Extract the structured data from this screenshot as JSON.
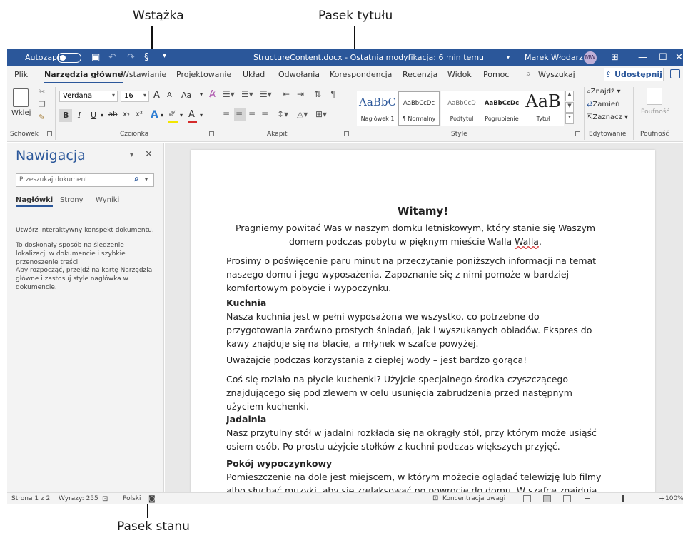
{
  "callouts": {
    "ribbon": "Wstążka",
    "titlebar": "Pasek tytułu",
    "statusbar": "Pasek stanu"
  },
  "titlebar": {
    "autosave_label": "Autozapis",
    "document_title": "StructureContent.docx - Ostatnia modyfikacja: 6 min temu",
    "title_chevron": "▾",
    "user_name": "Marek Włodarz",
    "user_initials": "MW"
  },
  "tabs": [
    "Plik",
    "Narzędzia główne",
    "Wstawianie",
    "Projektowanie",
    "Układ",
    "Odwołania",
    "Korespondencja",
    "Recenzja",
    "Widok",
    "Pomoc"
  ],
  "search_label": "Wyszukaj",
  "share_label": "Udostępnij",
  "ribbon": {
    "clipboard": {
      "paste_label": "Wklej",
      "group": "Schowek"
    },
    "font": {
      "family": "Verdana",
      "size": "16",
      "bold": "B",
      "italic": "I",
      "underline": "U",
      "strike": "ab",
      "sub": "x₂",
      "sup": "x²",
      "case_label": "Aa",
      "grow": "A",
      "shrink": "A",
      "highlight_color": "#f2e600",
      "font_color": "#d42b2b",
      "group": "Czcionka"
    },
    "paragraph": {
      "group": "Akapit"
    },
    "styles": {
      "items": [
        {
          "preview": "AaBbC",
          "label": "Nagłówek 1"
        },
        {
          "preview": "AaBbCcDc",
          "label": "¶ Normalny"
        },
        {
          "preview": "AaBbCcD",
          "label": "Podtytuł"
        },
        {
          "preview": "AaBbCcDc",
          "label": "Pogrubienie"
        },
        {
          "preview": "AaB",
          "label": "Tytuł"
        }
      ],
      "group": "Style"
    },
    "editing": {
      "find": "Znajdź",
      "replace": "Zamień",
      "select": "Zaznacz",
      "group": "Edytowanie"
    },
    "sensitivity": {
      "label": "Poufność",
      "group": "Poufność"
    }
  },
  "nav": {
    "title": "Nawigacja",
    "search_placeholder": "Przeszukaj dokument",
    "tabs": [
      "Nagłówki",
      "Strony",
      "Wyniki"
    ],
    "para1": "Utwórz interaktywny konspekt dokumentu.",
    "para2": "To doskonały sposób na śledzenie lokalizacji w dokumencie i szybkie przenoszenie treści.",
    "para3": "Aby rozpocząć, przejdź na kartę Narzędzia główne i zastosuj style nagłówka w dokumencie."
  },
  "document": {
    "heading": "Witamy!",
    "intro_a": "Pragniemy powitać Was w naszym domku letniskowym, który stanie się Waszym domem podczas pobytu w pięknym mieście Walla ",
    "intro_b": "Walla",
    "intro_c": ".",
    "p1": "Prosimy o poświęcenie paru minut na przeczytanie poniższych informacji na temat naszego domu i jego wyposażenia. Zapoznanie się z nimi pomoże w bardziej komfortowym pobycie i wypoczynku.",
    "h_kitchen": "Kuchnia",
    "p_kitchen": "Nasza kuchnia jest w pełni wyposażona we wszystko, co potrzebne do przygotowania zarówno prostych śniadań, jak i wyszukanych obiadów. Ekspres do kawy znajduje się na blacie, a młynek w szafce powyżej.",
    "p_water": "Uważajcie podczas korzystania z ciepłej wody – jest bardzo gorąca!",
    "p_stove": "Coś się rozlało na płycie kuchenki? Użyjcie specjalnego środka czyszczącego znajdującego się pod zlewem w celu usunięcia zabrudzenia przed następnym użyciem kuchenki.",
    "h_dining": "Jadalnia",
    "p_dining": "Nasz przytulny stół w jadalni rozkłada się na okrągły stół, przy którym może usiąść osiem osób. Po prostu użyjcie stołków z kuchni podczas większych przyjęć.",
    "h_living": "Pokój wypoczynkowy",
    "p_living": "Pomieszczenie na dole jest miejscem, w którym możecie oglądać telewizję lub filmy albo słuchać muzyki, aby się zrelaksować po powrocie do domu. W szafce znajdują"
  },
  "status": {
    "page": "Strona 1 z 2",
    "words": "Wyrazy: 255",
    "language": "Polski",
    "focus": "Koncentracja uwagi",
    "zoom": "100%",
    "zoom_minus": "−",
    "zoom_plus": "+"
  }
}
